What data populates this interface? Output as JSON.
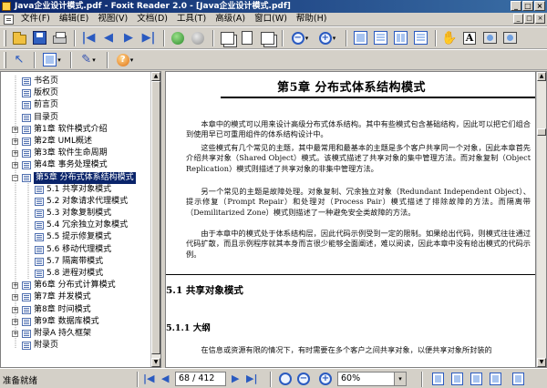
{
  "window": {
    "title": "Java企业设计模式.pdf - Foxit Reader 2.0 - [Java企业设计模式.pdf]",
    "minimize": "_",
    "maximize": "□",
    "close": "×"
  },
  "menu": {
    "items": [
      "文件(F)",
      "编辑(E)",
      "视图(V)",
      "文档(D)",
      "工具(T)",
      "高级(A)",
      "窗口(W)",
      "帮助(H)"
    ],
    "doc_controls": [
      "_",
      "□",
      "×"
    ]
  },
  "toolbar": {
    "first": "|◀",
    "prev": "◀",
    "next": "▶",
    "last": "▶|",
    "zoom_out": "−",
    "zoom_in": "+",
    "dropdown": "▾",
    "hand": "✋",
    "text_tool": "A",
    "select": "↖",
    "pen": "✎",
    "help": "?"
  },
  "bookmarks": [
    {
      "label": "书名页",
      "level": 0,
      "expander": ""
    },
    {
      "label": "版权页",
      "level": 0,
      "expander": ""
    },
    {
      "label": "前言页",
      "level": 0,
      "expander": ""
    },
    {
      "label": "目录页",
      "level": 0,
      "expander": ""
    },
    {
      "label": "第1章  软件模式介绍",
      "level": 0,
      "expander": "+"
    },
    {
      "label": "第2章  UML概述",
      "level": 0,
      "expander": "+"
    },
    {
      "label": "第3章  软件生命周期",
      "level": 0,
      "expander": "+"
    },
    {
      "label": "第4章  事务处理模式",
      "level": 0,
      "expander": "+"
    },
    {
      "label": "第5章  分布式体系结构模式",
      "level": 0,
      "expander": "−",
      "selected": true
    },
    {
      "label": "5.1  共享对象模式",
      "level": 1,
      "expander": ""
    },
    {
      "label": "5.2  对象请求代理模式",
      "level": 1,
      "expander": ""
    },
    {
      "label": "5.3  对象复制模式",
      "level": 1,
      "expander": ""
    },
    {
      "label": "5.4  冗余独立对象模式",
      "level": 1,
      "expander": ""
    },
    {
      "label": "5.5  提示修复模式",
      "level": 1,
      "expander": ""
    },
    {
      "label": "5.6  移动代理模式",
      "level": 1,
      "expander": ""
    },
    {
      "label": "5.7  隔离带模式",
      "level": 1,
      "expander": ""
    },
    {
      "label": "5.8  进程对模式",
      "level": 1,
      "expander": ""
    },
    {
      "label": "第6章  分布式计算模式",
      "level": 0,
      "expander": "+"
    },
    {
      "label": "第7章  并发模式",
      "level": 0,
      "expander": "+"
    },
    {
      "label": "第8章  时间模式",
      "level": 0,
      "expander": "+"
    },
    {
      "label": "第9章  数据库模式",
      "level": 0,
      "expander": "+"
    },
    {
      "label": "附录A  持久框架",
      "level": 0,
      "expander": "+"
    },
    {
      "label": "附录页",
      "level": 0,
      "expander": ""
    }
  ],
  "document": {
    "chapter_title": "第5章    分布式体系结构模式",
    "paragraphs": [
      "本章中的模式可以用来设计高级分布式体系结构。其中有些模式包含基础结构，因此可以把它们组合到使用早已可重用组件的体系结构设计中。",
      "这些模式有几个常见的主题，其中最常用和最基本的主题是多个客户共享同一个对象，因此本章首先介绍共享对象（Shared Object）模式。该模式描述了共享对象的集中管理方法。而对象复制（Object Replication）模式则描述了共享对象的非集中管理方法。",
      "另一个常见的主题是故障处理。对象复制、冗余独立对象（Redundant Independent Object）、提示修复（Prompt Repair）和处理对（Process Pair）模式描述了排除故障的方法。而隔离带（Demilitarized Zone）模式则描述了一种避免安全类故障的方法。",
      "由于本章中的模式处于体系结构层，因此代码示例受到一定的限制。如果给出代码，则模式往往通过代码扩散，而且示例程序就其本身而言很少能够全面阐述，难以阅读，因此本章中没有给出模式的代码示例。"
    ],
    "section_heading": "5.1    共享对象模式",
    "subsection_heading": "5.1.1    大纲",
    "last_line": "在信息或资源有限的情况下，有时需要在多个客户之间共享对象，以便共享对象所封装的"
  },
  "status": {
    "text": "准备就绪",
    "page": "68 / 412",
    "zoom": "60%",
    "first": "|◀",
    "prev": "◀",
    "next": "▶",
    "last": "▶|",
    "zoom_out": "−",
    "zoom_in": "+",
    "dropdown": "▾"
  }
}
